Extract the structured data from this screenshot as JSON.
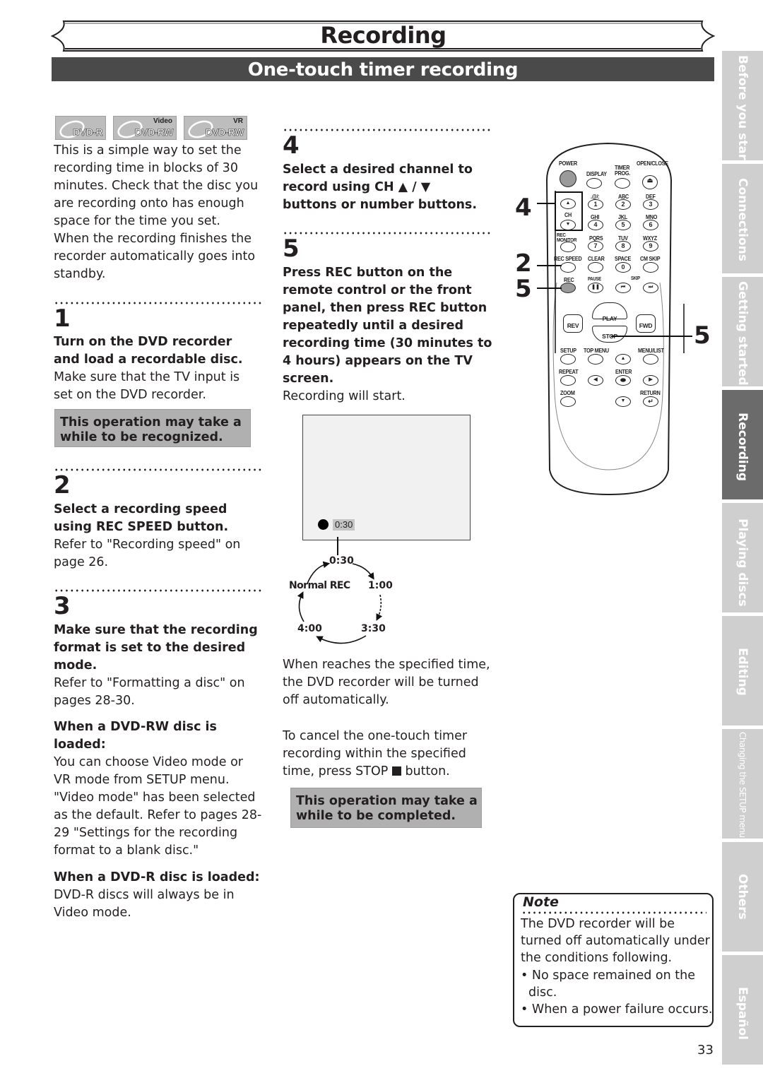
{
  "header": {
    "chapter_title": "Recording",
    "section_title": "One-touch timer recording"
  },
  "disc_badges": [
    {
      "name": "DVD-R",
      "sub": ""
    },
    {
      "name": "DVD-RW",
      "sub": "Video"
    },
    {
      "name": "DVD-RW",
      "sub": "VR"
    }
  ],
  "intro": "This is a simple way to set the recording time in blocks of 30 minutes. Check that the disc you are recording onto has enough space for the time you set. When the recording finishes the recorder automatically goes into standby.",
  "steps": [
    {
      "number": "1",
      "heading": "Turn on the DVD recorder and load a recordable disc.",
      "text": "Make sure that the TV input is set on the DVD recorder.",
      "callout": "This operation may take a while to be recognized."
    },
    {
      "number": "2",
      "heading": "Select a recording speed using REC SPEED button.",
      "text": "Refer to \"Recording speed\" on page 26."
    },
    {
      "number": "3",
      "heading": "Make sure that the recording format is set to the desired mode.",
      "text": "Refer to \"Formatting a disc\" on pages 28-30.",
      "sub_sections": [
        {
          "heading": "When a DVD-RW disc is loaded:",
          "text": "You can choose Video mode or VR mode from SETUP menu. \"Video mode\" has been selected as the default. Refer to pages 28-29 \"Settings for the recording format to a blank disc.\""
        },
        {
          "heading": "When a DVD-R disc is loaded:",
          "text": "DVD-R discs will always be in Video mode."
        }
      ]
    },
    {
      "number": "4",
      "heading": "Select a desired channel to record using CH ▲ / ▼ buttons or number buttons."
    },
    {
      "number": "5",
      "heading": "Press REC button on the remote control or the front panel, then press REC button repeatedly until a desired recording time (30 minutes to 4 hours) appears on the TV screen.",
      "text": "Recording will start."
    }
  ],
  "screen": {
    "osd_time": "0:30"
  },
  "cycle": {
    "labels": [
      "0:30",
      "1:00",
      "3:30",
      "4:00",
      "Normal REC"
    ]
  },
  "after_text": {
    "p1": "When reaches the specified time, the DVD recorder will be turned off automatically.",
    "p2_before": "To cancel the one-touch timer recording within the specified time, press STOP",
    "p2_after": "button.",
    "callout": "This operation may take a while to be completed."
  },
  "remote": {
    "callouts": [
      "4",
      "2",
      "5",
      "5"
    ],
    "labels": {
      "power": "POWER",
      "display": "DISPLAY",
      "timer_prog": "TIMER PROG.",
      "open_close": "OPEN/CLOSE",
      "k1": ".@/:",
      "k2": "ABC",
      "k3": "DEF",
      "k4": "GHI",
      "k5": "JKL",
      "k6": "MNO",
      "k7": "PQRS",
      "k8": "TUV",
      "k9": "WXYZ",
      "ch": "CH",
      "rec_monitor": "REC MONITOR",
      "rec_speed": "REC SPEED",
      "clear": "CLEAR",
      "space": "SPACE",
      "cm_skip": "CM SKIP",
      "rec": "REC",
      "pause": "PAUSE",
      "skip": "SKIP",
      "play": "PLAY",
      "rev": "REV",
      "fwd": "FWD",
      "stop": "STOP",
      "setup": "SETUP",
      "top_menu": "TOP MENU",
      "menu_list": "MENU/LIST",
      "repeat": "REPEAT",
      "enter": "ENTER",
      "zoom": "ZOOM",
      "return": "RETURN"
    },
    "digits": [
      "1",
      "2",
      "3",
      "4",
      "5",
      "6",
      "7",
      "8",
      "9",
      "0"
    ]
  },
  "note": {
    "title": "Note",
    "text": "The DVD recorder will be turned off automatically under the conditions following.",
    "bullets": [
      "No space remained on the disc.",
      "When a power failure occurs."
    ]
  },
  "side_tabs": [
    {
      "label": "Before you start",
      "active": false
    },
    {
      "label": "Connections",
      "active": false
    },
    {
      "label": "Getting started",
      "active": false
    },
    {
      "label": "Recording",
      "active": true
    },
    {
      "label": "Playing discs",
      "active": false
    },
    {
      "label": "Editing",
      "active": false
    },
    {
      "label": "Changing the SETUP menu",
      "active": false
    },
    {
      "label": "Others",
      "active": false
    },
    {
      "label": "Español",
      "active": false
    }
  ],
  "page_number": "33",
  "colors": {
    "section_bar": "#4a4a4a",
    "callout_gray": "#b0b0b0",
    "tab_gray": "#cfcfcf",
    "tab_active": "#6b6b6b"
  }
}
